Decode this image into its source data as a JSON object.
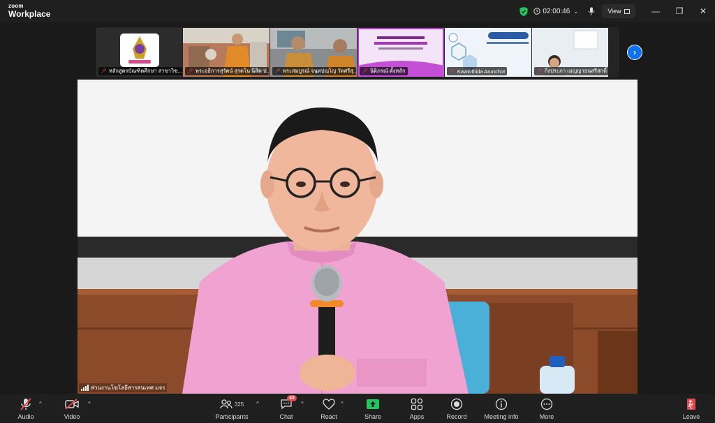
{
  "app": {
    "brand_top": "zoom",
    "brand_bottom": "Workplace"
  },
  "titlebar": {
    "timer": "02:00:46",
    "view_label": "View"
  },
  "gallery": {
    "tiles": [
      {
        "name": "หลักสูตรบัณฑิตศึกษา สาขาวิช..."
      },
      {
        "name": "พระอธิการสุรัตน์ สุรตโน นิสิต ป..."
      },
      {
        "name": "พระสมบูรณ์ จนฺทปญฺโญ วัดศรีสุ..."
      },
      {
        "name": "นิติภรณ์ ตั้งหลัก"
      },
      {
        "name": "Kawinthida Arunchot"
      },
      {
        "name": "กิ่งประภา เมญญาธนสรีสกดิ์"
      }
    ]
  },
  "speaker": {
    "name": "ส่วนงานโฆโลยีสารสนเทศ มจร"
  },
  "toolbar": {
    "audio": "Audio",
    "video": "Video",
    "participants": "Participants",
    "participants_count": "325",
    "chat": "Chat",
    "chat_badge": "43",
    "react": "React",
    "share": "Share",
    "apps": "Apps",
    "record": "Record",
    "meeting_info": "Meeting info",
    "more": "More",
    "leave": "Leave"
  },
  "colors": {
    "accent": "#0e72ed",
    "share_green": "#22c55e",
    "danger": "#e5484d",
    "shield_green": "#22c55e"
  }
}
